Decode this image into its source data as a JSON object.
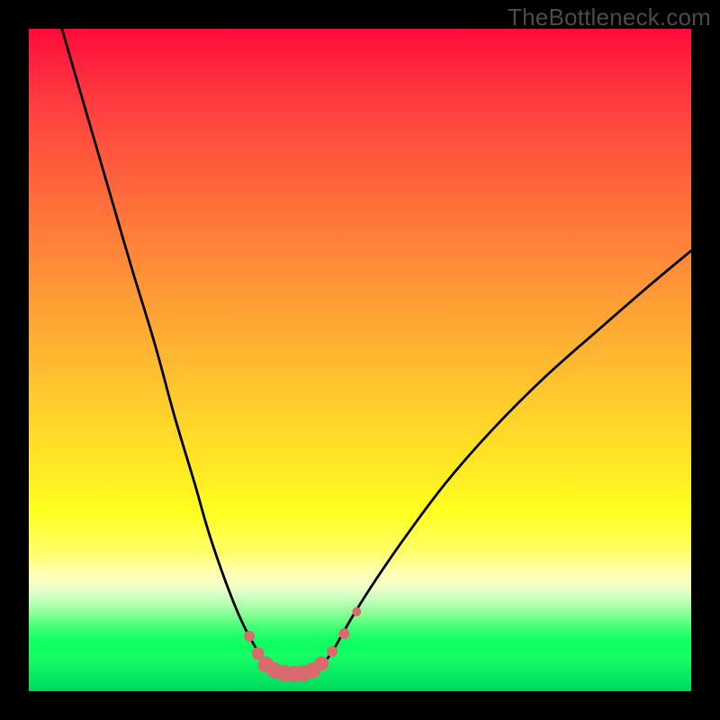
{
  "watermark": "TheBottleneck.com",
  "chart_data": {
    "type": "line",
    "title": "",
    "xlabel": "",
    "ylabel": "",
    "xlim": [
      0,
      100
    ],
    "ylim": [
      0,
      100
    ],
    "grid": false,
    "legend": false,
    "curve_color": "#000000",
    "marker_color": "#d86b6c",
    "series": [
      {
        "name": "left-branch",
        "x": [
          5.0,
          8.5,
          12.0,
          15.5,
          19.0,
          22.0,
          25.0,
          27.0,
          29.0,
          31.0,
          32.5,
          34.0,
          35.2,
          36.0
        ],
        "y": [
          100.0,
          88.0,
          76.0,
          64.0,
          52.5,
          41.5,
          31.5,
          24.5,
          18.5,
          13.2,
          9.8,
          7.0,
          5.0,
          3.8
        ]
      },
      {
        "name": "right-branch",
        "x": [
          44.0,
          45.5,
          47.0,
          49.0,
          52.5,
          57.0,
          63.0,
          70.0,
          78.0,
          86.5,
          94.0,
          100.0
        ],
        "y": [
          3.8,
          5.5,
          8.0,
          11.5,
          17.0,
          23.5,
          31.5,
          39.5,
          47.5,
          55.0,
          61.5,
          66.5
        ]
      },
      {
        "name": "valley-floor",
        "x": [
          36.0,
          37.5,
          39.5,
          41.5,
          43.0,
          44.0
        ],
        "y": [
          3.8,
          3.0,
          2.7,
          2.7,
          3.0,
          3.8
        ]
      }
    ],
    "markers": [
      {
        "x": 33.3,
        "y": 8.3,
        "r": 6
      },
      {
        "x": 34.6,
        "y": 5.7,
        "r": 7
      },
      {
        "x": 35.8,
        "y": 4.0,
        "r": 9
      },
      {
        "x": 37.2,
        "y": 3.1,
        "r": 9
      },
      {
        "x": 38.6,
        "y": 2.7,
        "r": 9
      },
      {
        "x": 40.0,
        "y": 2.6,
        "r": 9
      },
      {
        "x": 41.4,
        "y": 2.7,
        "r": 9
      },
      {
        "x": 42.8,
        "y": 3.1,
        "r": 9
      },
      {
        "x": 44.2,
        "y": 4.2,
        "r": 8
      },
      {
        "x": 45.8,
        "y": 6.0,
        "r": 6
      },
      {
        "x": 47.6,
        "y": 8.7,
        "r": 6
      },
      {
        "x": 49.5,
        "y": 12.0,
        "r": 5
      }
    ],
    "gradient_stops": [
      {
        "pos": 0,
        "color": "#ff0a3a"
      },
      {
        "pos": 12,
        "color": "#ff4040"
      },
      {
        "pos": 30,
        "color": "#ff7a3a"
      },
      {
        "pos": 55,
        "color": "#ffc82e"
      },
      {
        "pos": 73,
        "color": "#ffff20"
      },
      {
        "pos": 86,
        "color": "#caffc0"
      },
      {
        "pos": 93,
        "color": "#0cff5f"
      },
      {
        "pos": 100,
        "color": "#00d659"
      }
    ]
  }
}
